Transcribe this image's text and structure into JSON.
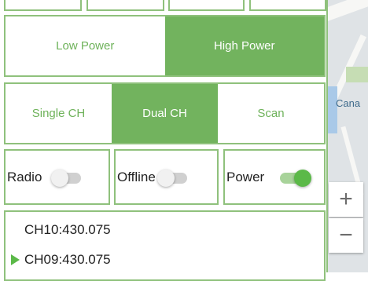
{
  "power_mode": {
    "options": [
      "Low Power",
      "High Power"
    ],
    "selected": "High Power"
  },
  "channel_mode": {
    "options": [
      "Single CH",
      "Dual CH",
      "Scan"
    ],
    "selected": "Dual CH"
  },
  "toggles": [
    {
      "label": "Radio",
      "on": false
    },
    {
      "label": "Offline",
      "on": false
    },
    {
      "label": "Power",
      "on": true
    }
  ],
  "channels": [
    {
      "label": "CH10:430.075",
      "selected": false
    },
    {
      "label": "CH09:430.075",
      "selected": true
    }
  ],
  "map": {
    "label": "Cana",
    "zoom_in": "+",
    "zoom_out": "−"
  },
  "colors": {
    "accent": "#72b35e",
    "border": "#8fc17c",
    "text": "#222222"
  }
}
